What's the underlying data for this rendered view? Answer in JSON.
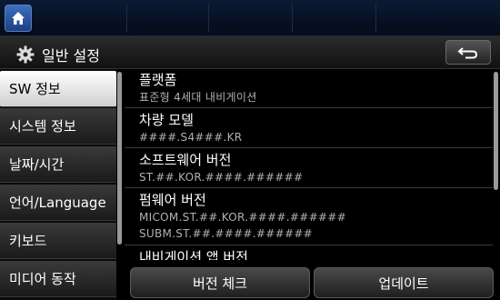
{
  "header": {
    "home_icon": "home-icon"
  },
  "titlebar": {
    "gear_icon": "gear-icon",
    "title": "일반 설정",
    "back_icon": "back-arrow-icon"
  },
  "sidebar": {
    "items": [
      {
        "label": "SW 정보",
        "active": true
      },
      {
        "label": "시스템 정보",
        "active": false
      },
      {
        "label": "날짜/시간",
        "active": false
      },
      {
        "label": "언어/Language",
        "active": false
      },
      {
        "label": "키보드",
        "active": false
      },
      {
        "label": "미디어 동작",
        "active": false
      }
    ]
  },
  "info": {
    "rows": [
      {
        "label": "플랫폼",
        "values": [
          "표준형 4세대 내비게이션"
        ]
      },
      {
        "label": "차량 모델",
        "values": [
          "####.S4###.KR"
        ]
      },
      {
        "label": "소프트웨어 버전",
        "values": [
          "ST.##.KOR.####.######"
        ]
      },
      {
        "label": "펌웨어 버전",
        "values": [
          "MICOM.ST.##.KOR.####.######",
          "SUBM.ST.##.####.######"
        ]
      },
      {
        "label": "내비게이션 앱 버전",
        "values": []
      }
    ]
  },
  "buttons": {
    "version_check": "버전 체크",
    "update": "업데이트"
  },
  "colors": {
    "top_bar": "#0b1a33",
    "home_button": "#2f5fb0",
    "active_item": "#ffffff"
  }
}
